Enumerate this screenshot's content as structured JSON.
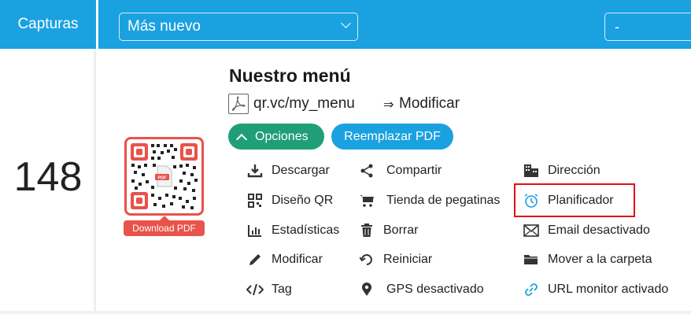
{
  "header": {
    "column_title": "Capturas",
    "sort_value": "Más nuevo",
    "filter_value": "-"
  },
  "colors": {
    "header_bg": "#1aa1e0",
    "options_button": "#1f9e78",
    "replace_button": "#1aa1e0",
    "qr_frame": "#e8534a",
    "highlight": "#e01010"
  },
  "qr_item": {
    "scans": "148",
    "title": "Nuestro menú",
    "type_icon": "pdf-file-icon",
    "short_url": "qr.vc/my_menu",
    "arrow": "⇒",
    "modify_label": "Modificar",
    "qr_caption": "Download PDF",
    "options_label": "Opciones",
    "replace_label": "Reemplazar PDF"
  },
  "actions": {
    "col1": [
      {
        "label": "Descargar",
        "icon": "download-icon"
      },
      {
        "label": "Diseño QR",
        "icon": "qr-design-icon"
      },
      {
        "label": "Estadísticas",
        "icon": "bar-chart-icon"
      },
      {
        "label": "Modificar",
        "icon": "pencil-icon"
      },
      {
        "label": "Tag",
        "icon": "code-icon"
      }
    ],
    "col2": [
      {
        "label": "Compartir",
        "icon": "share-icon"
      },
      {
        "label": "Tienda de pegatinas",
        "icon": "cart-icon"
      },
      {
        "label": "Borrar",
        "icon": "trash-icon"
      },
      {
        "label": "Reiniciar",
        "icon": "undo-icon"
      },
      {
        "label": "GPS desactivado",
        "icon": "map-pin-icon"
      }
    ],
    "col3": [
      {
        "label": "Dirección",
        "icon": "building-icon"
      },
      {
        "label": "Planificador",
        "icon": "alarm-clock-icon"
      },
      {
        "label": "Email desactivado",
        "icon": "envelope-icon"
      },
      {
        "label": "Mover a la carpeta",
        "icon": "folder-icon"
      },
      {
        "label": "URL monitor activado",
        "icon": "link-icon"
      }
    ]
  }
}
